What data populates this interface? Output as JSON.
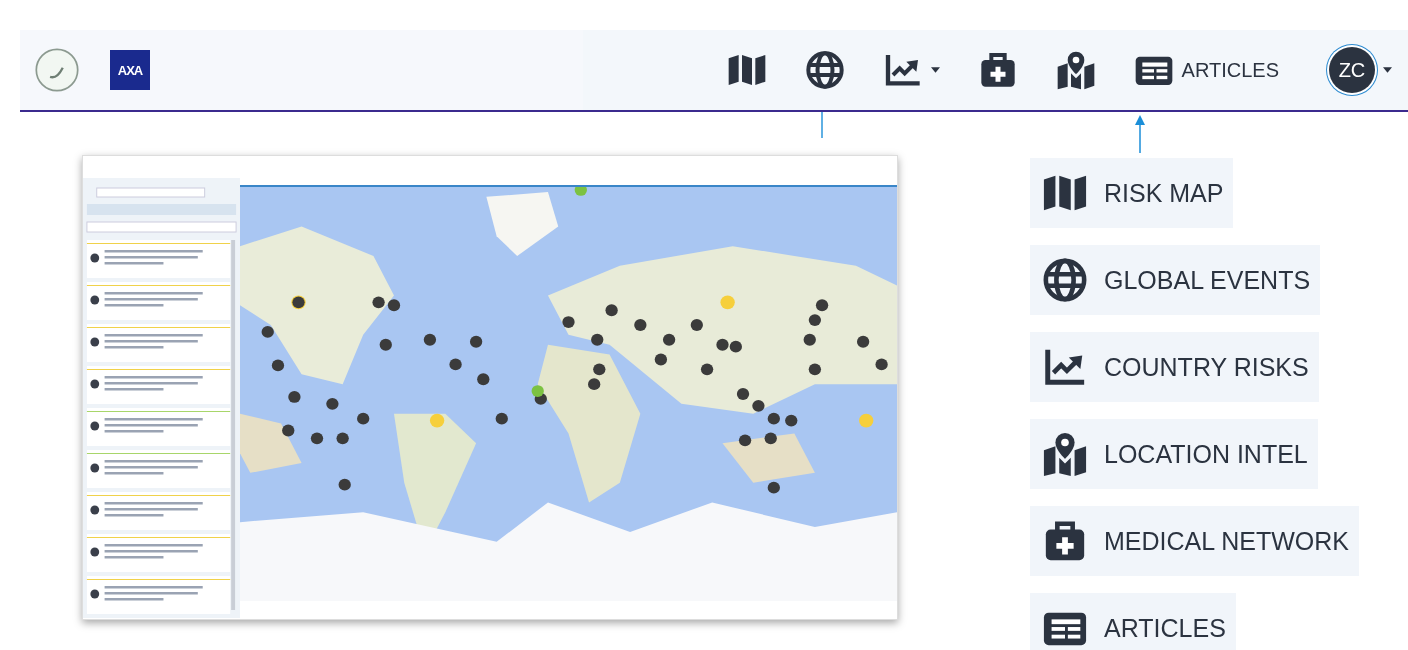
{
  "header": {
    "brand": {
      "logo_text": "AXA"
    },
    "nav": [
      {
        "kind": "map",
        "has_dropdown": false
      },
      {
        "kind": "globe",
        "has_dropdown": false
      },
      {
        "kind": "chart",
        "has_dropdown": true
      },
      {
        "kind": "medical",
        "has_dropdown": false
      },
      {
        "kind": "location",
        "has_dropdown": false
      },
      {
        "kind": "articles",
        "label": "ARTICLES",
        "has_dropdown": false
      }
    ],
    "user": {
      "initials": "ZC",
      "has_dropdown": true
    }
  },
  "menu": [
    {
      "kind": "map",
      "label": "RISK MAP"
    },
    {
      "kind": "globe",
      "label": "GLOBAL EVENTS"
    },
    {
      "kind": "chart",
      "label": "COUNTRY RISKS"
    },
    {
      "kind": "location",
      "label": "LOCATION INTEL"
    },
    {
      "kind": "medical",
      "label": "MEDICAL NETWORK"
    },
    {
      "kind": "articles",
      "label": "ARTICLES"
    }
  ]
}
